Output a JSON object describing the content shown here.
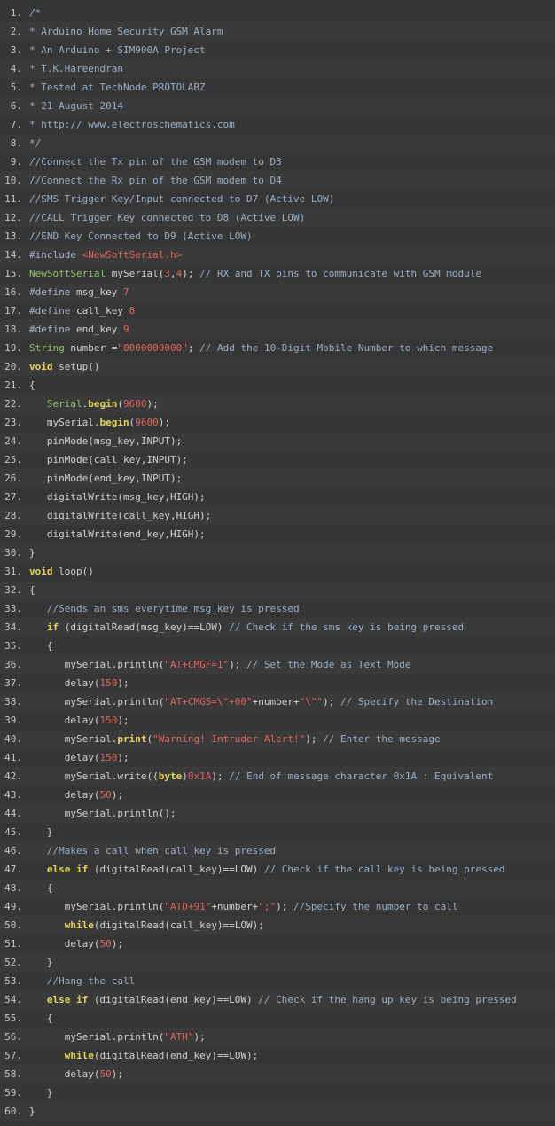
{
  "code": {
    "language": "arduino-c",
    "lines": [
      [
        {
          "t": "/*",
          "c": "cm"
        }
      ],
      [
        {
          "t": "* Arduino Home Security GSM Alarm",
          "c": "cm"
        }
      ],
      [
        {
          "t": "* An Arduino + SIM900A Project",
          "c": "cm"
        }
      ],
      [
        {
          "t": "* T.K.Hareendran",
          "c": "cm"
        }
      ],
      [
        {
          "t": "* Tested at TechNode PROTOLABZ",
          "c": "cm"
        }
      ],
      [
        {
          "t": "* 21 August 2014",
          "c": "cm"
        }
      ],
      [
        {
          "t": "* http:// www.electroschematics.com",
          "c": "cm"
        }
      ],
      [
        {
          "t": "*/",
          "c": "cm"
        }
      ],
      [
        {
          "t": "//Connect the Tx pin of the GSM modem to D3",
          "c": "cm"
        }
      ],
      [
        {
          "t": "//Connect the Rx pin of the GSM modem to D4",
          "c": "cm"
        }
      ],
      [
        {
          "t": "//SMS Trigger Key/Input connected to D7 (Active LOW)",
          "c": "cm"
        }
      ],
      [
        {
          "t": "//CALL Trigger Key connected to D8 (Active LOW)",
          "c": "cm"
        }
      ],
      [
        {
          "t": "//END Key Connected to D9 (Active LOW)",
          "c": "cm"
        }
      ],
      [
        {
          "t": "#include ",
          "c": "pp"
        },
        {
          "t": "<NewSoftSerial.h>",
          "c": "str"
        }
      ],
      [
        {
          "t": "NewSoftSerial",
          "c": "ty"
        },
        {
          "t": " mySerial(",
          "c": "pl"
        },
        {
          "t": "3",
          "c": "num"
        },
        {
          "t": ",",
          "c": "pl"
        },
        {
          "t": "4",
          "c": "num"
        },
        {
          "t": "); ",
          "c": "pl"
        },
        {
          "t": "// RX and TX pins to communicate with GSM module",
          "c": "cm"
        }
      ],
      [
        {
          "t": "#define ",
          "c": "pp"
        },
        {
          "t": "msg_key ",
          "c": "pl"
        },
        {
          "t": "7",
          "c": "num"
        }
      ],
      [
        {
          "t": "#define ",
          "c": "pp"
        },
        {
          "t": "call_key ",
          "c": "pl"
        },
        {
          "t": "8",
          "c": "num"
        }
      ],
      [
        {
          "t": "#define ",
          "c": "pp"
        },
        {
          "t": "end_key ",
          "c": "pl"
        },
        {
          "t": "9",
          "c": "num"
        }
      ],
      [
        {
          "t": "String",
          "c": "ty"
        },
        {
          "t": " number =",
          "c": "pl"
        },
        {
          "t": "\"0000000000\"",
          "c": "str"
        },
        {
          "t": "; ",
          "c": "pl"
        },
        {
          "t": "// Add the 10-Digit Mobile Number to which message",
          "c": "cm"
        }
      ],
      [
        {
          "t": "void",
          "c": "kw"
        },
        {
          "t": " setup()",
          "c": "pl"
        }
      ],
      [
        {
          "t": "{",
          "c": "pl"
        }
      ],
      [
        {
          "t": "   ",
          "c": "pl"
        },
        {
          "t": "Serial",
          "c": "ty"
        },
        {
          "t": ".",
          "c": "pl"
        },
        {
          "t": "begin",
          "c": "fn"
        },
        {
          "t": "(",
          "c": "pl"
        },
        {
          "t": "9600",
          "c": "num"
        },
        {
          "t": ");",
          "c": "pl"
        }
      ],
      [
        {
          "t": "   mySerial.",
          "c": "pl"
        },
        {
          "t": "begin",
          "c": "fn"
        },
        {
          "t": "(",
          "c": "pl"
        },
        {
          "t": "9600",
          "c": "num"
        },
        {
          "t": ");",
          "c": "pl"
        }
      ],
      [
        {
          "t": "   pinMode(msg_key,INPUT);",
          "c": "pl"
        }
      ],
      [
        {
          "t": "   pinMode(call_key,INPUT);",
          "c": "pl"
        }
      ],
      [
        {
          "t": "   pinMode(end_key,INPUT);",
          "c": "pl"
        }
      ],
      [
        {
          "t": "   digitalWrite(msg_key,HIGH);",
          "c": "pl"
        }
      ],
      [
        {
          "t": "   digitalWrite(call_key,HIGH);",
          "c": "pl"
        }
      ],
      [
        {
          "t": "   digitalWrite(end_key,HIGH);",
          "c": "pl"
        }
      ],
      [
        {
          "t": "}",
          "c": "pl"
        }
      ],
      [
        {
          "t": "void",
          "c": "kw"
        },
        {
          "t": " loop()",
          "c": "pl"
        }
      ],
      [
        {
          "t": "{",
          "c": "pl"
        }
      ],
      [
        {
          "t": "   ",
          "c": "pl"
        },
        {
          "t": "//Sends an sms everytime msg_key is pressed",
          "c": "cm"
        }
      ],
      [
        {
          "t": "   ",
          "c": "pl"
        },
        {
          "t": "if",
          "c": "kw"
        },
        {
          "t": " (digitalRead(msg_key)==LOW) ",
          "c": "pl"
        },
        {
          "t": "// Check if the sms key is being pressed",
          "c": "cm"
        }
      ],
      [
        {
          "t": "   {",
          "c": "pl"
        }
      ],
      [
        {
          "t": "      mySerial.println(",
          "c": "pl"
        },
        {
          "t": "\"AT+CMGF=1\"",
          "c": "str"
        },
        {
          "t": "); ",
          "c": "pl"
        },
        {
          "t": "// Set the Mode as Text Mode",
          "c": "cm"
        }
      ],
      [
        {
          "t": "      delay(",
          "c": "pl"
        },
        {
          "t": "150",
          "c": "num"
        },
        {
          "t": ");",
          "c": "pl"
        }
      ],
      [
        {
          "t": "      mySerial.println(",
          "c": "pl"
        },
        {
          "t": "\"AT+CMGS=\\\"+00\"",
          "c": "str"
        },
        {
          "t": "+number+",
          "c": "pl"
        },
        {
          "t": "\"\\\"\"",
          "c": "str"
        },
        {
          "t": "); ",
          "c": "pl"
        },
        {
          "t": "// Specify the Destination",
          "c": "cm"
        }
      ],
      [
        {
          "t": "      delay(",
          "c": "pl"
        },
        {
          "t": "150",
          "c": "num"
        },
        {
          "t": ");",
          "c": "pl"
        }
      ],
      [
        {
          "t": "      mySerial.",
          "c": "pl"
        },
        {
          "t": "print",
          "c": "fn"
        },
        {
          "t": "(",
          "c": "pl"
        },
        {
          "t": "\"Warning! Intruder Alert!\"",
          "c": "str"
        },
        {
          "t": "); ",
          "c": "pl"
        },
        {
          "t": "// Enter the message",
          "c": "cm"
        }
      ],
      [
        {
          "t": "      delay(",
          "c": "pl"
        },
        {
          "t": "150",
          "c": "num"
        },
        {
          "t": ");",
          "c": "pl"
        }
      ],
      [
        {
          "t": "      mySerial.write((",
          "c": "pl"
        },
        {
          "t": "byte",
          "c": "kw"
        },
        {
          "t": ")",
          "c": "pl"
        },
        {
          "t": "0x1A",
          "c": "num"
        },
        {
          "t": "); ",
          "c": "pl"
        },
        {
          "t": "// End of message character 0x1A : Equivalent",
          "c": "cm"
        }
      ],
      [
        {
          "t": "      delay(",
          "c": "pl"
        },
        {
          "t": "50",
          "c": "num"
        },
        {
          "t": ");",
          "c": "pl"
        }
      ],
      [
        {
          "t": "      mySerial.println();",
          "c": "pl"
        }
      ],
      [
        {
          "t": "   }",
          "c": "pl"
        }
      ],
      [
        {
          "t": "   ",
          "c": "pl"
        },
        {
          "t": "//Makes a call when call_key is pressed",
          "c": "cm"
        }
      ],
      [
        {
          "t": "   ",
          "c": "pl"
        },
        {
          "t": "else if",
          "c": "kw"
        },
        {
          "t": " (digitalRead(call_key)==LOW) ",
          "c": "pl"
        },
        {
          "t": "// Check if the call key is being pressed",
          "c": "cm"
        }
      ],
      [
        {
          "t": "   {",
          "c": "pl"
        }
      ],
      [
        {
          "t": "      mySerial.println(",
          "c": "pl"
        },
        {
          "t": "\"ATD+91\"",
          "c": "str"
        },
        {
          "t": "+number+",
          "c": "pl"
        },
        {
          "t": "\";\"",
          "c": "str"
        },
        {
          "t": "); ",
          "c": "pl"
        },
        {
          "t": "//Specify the number to call",
          "c": "cm"
        }
      ],
      [
        {
          "t": "      ",
          "c": "pl"
        },
        {
          "t": "while",
          "c": "kw"
        },
        {
          "t": "(digitalRead(call_key)==LOW);",
          "c": "pl"
        }
      ],
      [
        {
          "t": "      delay(",
          "c": "pl"
        },
        {
          "t": "50",
          "c": "num"
        },
        {
          "t": ");",
          "c": "pl"
        }
      ],
      [
        {
          "t": "   }",
          "c": "pl"
        }
      ],
      [
        {
          "t": "   ",
          "c": "pl"
        },
        {
          "t": "//Hang the call",
          "c": "cm"
        }
      ],
      [
        {
          "t": "   ",
          "c": "pl"
        },
        {
          "t": "else if",
          "c": "kw"
        },
        {
          "t": " (digitalRead(end_key)==LOW) ",
          "c": "pl"
        },
        {
          "t": "// Check if the hang up key is being pressed",
          "c": "cm"
        }
      ],
      [
        {
          "t": "   {",
          "c": "pl"
        }
      ],
      [
        {
          "t": "      mySerial.println(",
          "c": "pl"
        },
        {
          "t": "\"ATH\"",
          "c": "str"
        },
        {
          "t": ");",
          "c": "pl"
        }
      ],
      [
        {
          "t": "      ",
          "c": "pl"
        },
        {
          "t": "while",
          "c": "kw"
        },
        {
          "t": "(digitalRead(end_key)==LOW);",
          "c": "pl"
        }
      ],
      [
        {
          "t": "      delay(",
          "c": "pl"
        },
        {
          "t": "50",
          "c": "num"
        },
        {
          "t": ");",
          "c": "pl"
        }
      ],
      [
        {
          "t": "   }",
          "c": "pl"
        }
      ],
      [
        {
          "t": "}",
          "c": "pl"
        }
      ]
    ]
  },
  "colors": {
    "background": "#363636",
    "comment": "#9aaec4",
    "keyword": "#e7d45a",
    "type": "#8fc46a",
    "number_string": "#e0645e",
    "plain": "#d2d2d2"
  }
}
